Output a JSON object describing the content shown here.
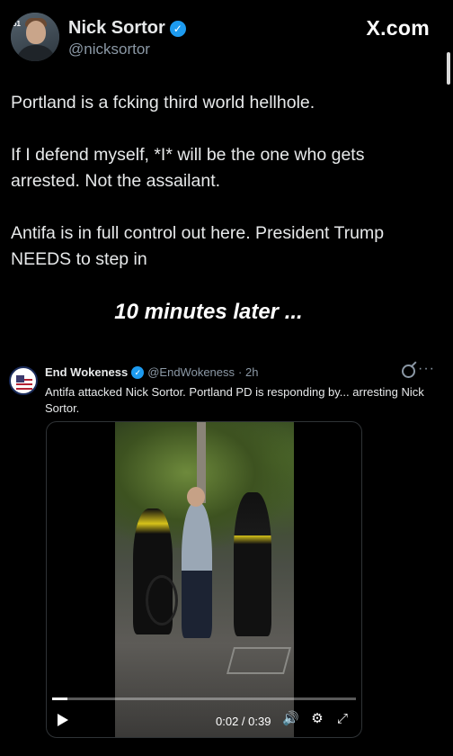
{
  "header": {
    "display_name": "Nick Sortor",
    "handle": "@nicksortor",
    "brand": "X.com",
    "verified_color": "#1d9bf0",
    "avatar_sticker": "51"
  },
  "tweet": {
    "paragraphs": [
      "Portland is a fcking third world hellhole.",
      "If I defend myself, *I* will be the one who gets arrested. Not the assailant.",
      "Antifa is in full control out here. President Trump NEEDS to step in"
    ]
  },
  "overlay_caption": "10 minutes later ...",
  "quote": {
    "display_name": "End Wokeness",
    "handle": "@EndWokeness",
    "time": "· 2h",
    "more": "···",
    "text": "Antifa attacked Nick Sortor. Portland PD is responding by... arresting Nick Sortor.",
    "video": {
      "time_display": "0:02 / 0:39",
      "progress": 0.05,
      "volume_icon": "🔊",
      "settings_icon": "⚙",
      "expand_icon": "⤢"
    }
  }
}
